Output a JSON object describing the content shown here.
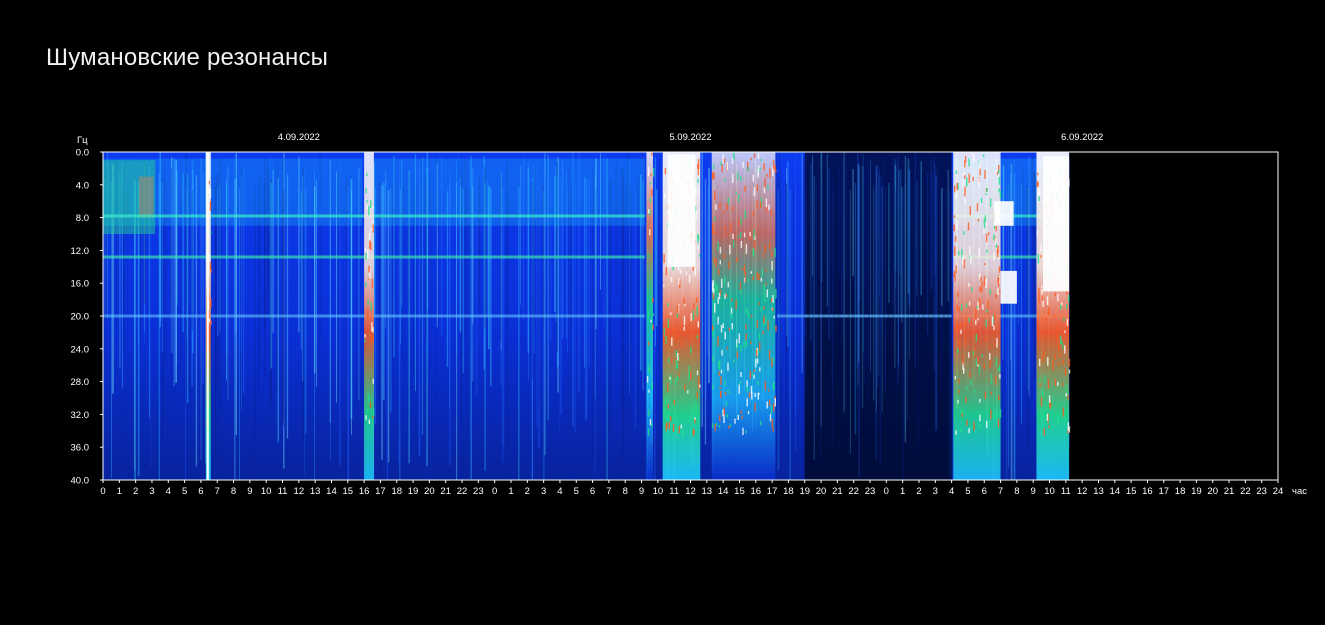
{
  "page": {
    "title": "Шумановские резонансы"
  },
  "chart_data": {
    "type": "heatmap",
    "title": "",
    "ylabel": "Гц",
    "xlabel": "час",
    "ylim": [
      0,
      40
    ],
    "y_ticks": [
      "0.0",
      "4.0",
      "8.0",
      "12.0",
      "16.0",
      "20.0",
      "24.0",
      "28.0",
      "32.0",
      "36.0",
      "40.0"
    ],
    "x_ticks": [
      "0",
      "1",
      "2",
      "3",
      "4",
      "5",
      "6",
      "7",
      "8",
      "9",
      "10",
      "11",
      "12",
      "13",
      "14",
      "15",
      "16",
      "17",
      "18",
      "19",
      "20",
      "21",
      "22",
      "23",
      "0",
      "1",
      "2",
      "3",
      "4",
      "5",
      "6",
      "7",
      "8",
      "9",
      "10",
      "11",
      "12",
      "13",
      "14",
      "15",
      "16",
      "17",
      "18",
      "19",
      "20",
      "21",
      "22",
      "23",
      "0",
      "1",
      "2",
      "3",
      "4",
      "5",
      "6",
      "7",
      "8",
      "9",
      "10",
      "11",
      "12",
      "13",
      "14",
      "15",
      "16",
      "17",
      "18",
      "19",
      "20",
      "21",
      "22",
      "23",
      "24"
    ],
    "days": [
      {
        "label": "4.09.2022",
        "start_hour": 0
      },
      {
        "label": "5.09.2022",
        "start_hour": 24
      },
      {
        "label": "6.09.2022",
        "start_hour": 48
      }
    ],
    "x_range_hours": [
      0,
      72
    ],
    "data_end_hour": 59.2,
    "resonance_bands_hz": [
      7.8,
      12.8,
      20.0
    ],
    "bursts": [
      {
        "start": 6.3,
        "end": 6.6,
        "intensity": 1.0
      },
      {
        "start": 16.0,
        "end": 16.6,
        "intensity": 0.95
      },
      {
        "start": 33.3,
        "end": 33.7,
        "intensity": 0.9
      },
      {
        "start": 34.3,
        "end": 36.6,
        "intensity": 1.0
      },
      {
        "start": 37.3,
        "end": 41.2,
        "intensity": 0.8
      },
      {
        "start": 52.1,
        "end": 55.0,
        "intensity": 0.95
      },
      {
        "start": 57.2,
        "end": 59.2,
        "intensity": 1.0
      }
    ],
    "quiet_period": {
      "start": 43.0,
      "end": 52.0
    },
    "colors": {
      "background": "#000000",
      "field": "#0a2fd6",
      "low": "#001a6e",
      "mid": "#1ec8ff",
      "high": "#22e08a",
      "peak": "#ff5a1e",
      "saturated": "#ffffff"
    }
  }
}
